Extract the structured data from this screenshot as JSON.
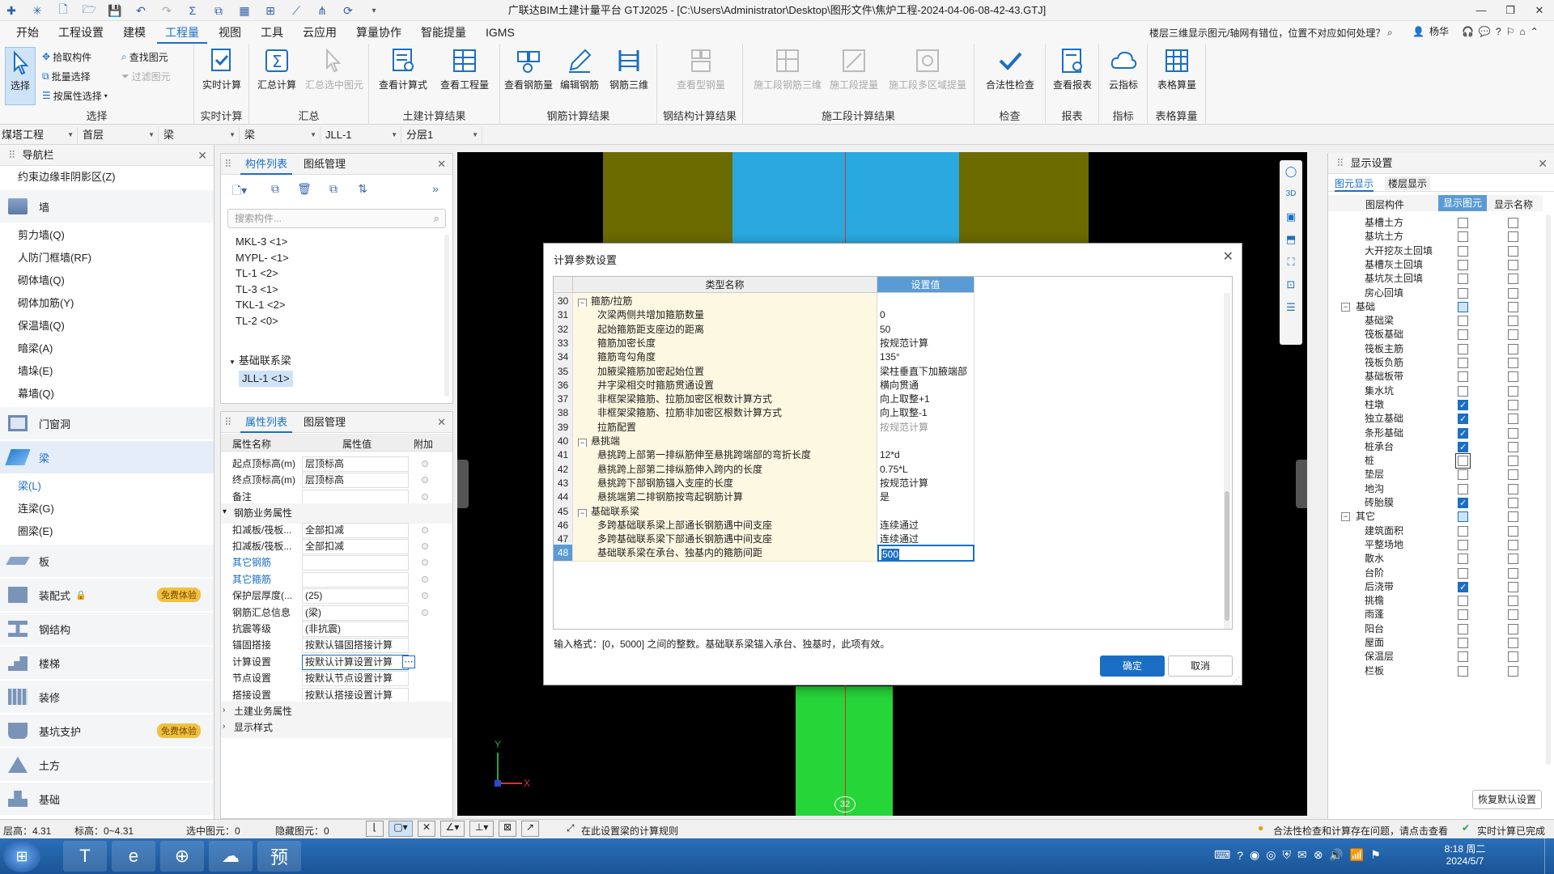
{
  "titlebar": {
    "title": "广联达BIM土建计量平台 GTJ2025 - [C:\\Users\\Administrator\\Desktop\\图形文件\\焦炉工程-2024-04-06-08-42-43.GTJ]",
    "qa_dropdown": "▾"
  },
  "menu": {
    "tabs": [
      "开始",
      "工程设置",
      "建模",
      "工程量",
      "视图",
      "工具",
      "云应用",
      "算量协作",
      "智能提量",
      "IGMS"
    ],
    "active": "工程量",
    "search": "楼层三维显示图元/轴网有错位，位置不对应如何处理？",
    "user": "杨华"
  },
  "ribbon": {
    "select": {
      "label": "选择",
      "pick": "拾取构件",
      "batch": "批量选择",
      "by_attr": "按属性选择",
      "find": "查找图元",
      "filter": "过滤图元",
      "group": "选择"
    },
    "realtime": {
      "label": "实时计算",
      "group": "实时计算"
    },
    "summary": {
      "calc": "汇总计算",
      "sel": "汇总选中图元",
      "group": "汇总"
    },
    "civil": {
      "formula": "查看计算式",
      "quantity": "查看工程量",
      "group": "土建计算结果"
    },
    "rebar": {
      "view": "查看钢筋量",
      "edit": "编辑钢筋",
      "threed": "钢筋三维",
      "group": "钢筋计算结果"
    },
    "steel": {
      "view": "查看型钢量",
      "group": "钢结构计算结果"
    },
    "construction": {
      "rebar3d": "施工段钢筋三维",
      "extract": "施工段提量",
      "multi": "施工段多区域提量",
      "group": "施工段计算结果"
    },
    "check": {
      "label": "合法性检查",
      "group": "检查"
    },
    "report": {
      "label": "查看报表",
      "group": "报表"
    },
    "index": {
      "label": "云指标",
      "group": "指标"
    },
    "table": {
      "label": "表格算量",
      "group": "表格算量"
    }
  },
  "selectors": {
    "project": "煤塔工程",
    "floor": "首层",
    "type": "梁",
    "subtype": "梁",
    "component": "JLL-1",
    "layer": "分层1"
  },
  "nav": {
    "title": "导航栏",
    "top_item": "约束边缘非阴影区(Z)",
    "cat_wall": "墙",
    "wall_items": [
      "剪力墙(Q)",
      "人防门框墙(RF)",
      "砌体墙(Q)",
      "砌体加筋(Y)",
      "保温墙(Q)",
      "暗梁(A)",
      "墙垛(E)",
      "幕墙(Q)"
    ],
    "cat_door": "门窗洞",
    "cat_beam": "梁",
    "beam_items": [
      "梁(L)",
      "连梁(G)",
      "圈梁(E)"
    ],
    "cat_slab": "板",
    "cat_prefab": "装配式",
    "cat_steel": "钢结构",
    "cat_stair": "楼梯",
    "cat_deco": "装修",
    "cat_pit": "基坑支护",
    "cat_earth": "土方",
    "cat_found": "基础",
    "badge": "免费体验"
  },
  "complist": {
    "tab1": "构件列表",
    "tab2": "图纸管理",
    "search_placeholder": "搜索构件...",
    "items": [
      "MKL-3 <1>",
      "MYPL- <1>",
      "TL-1 <2>",
      "TL-3 <1>",
      "TKL-1 <2>",
      "TL-2 <0>"
    ],
    "group": "基础联系梁",
    "current": "JLL-1 <1>"
  },
  "props": {
    "tab1": "属性列表",
    "tab2": "图层管理",
    "col_name": "属性名称",
    "col_value": "属性值",
    "col_extra": "附加",
    "rows": [
      {
        "n": "起点顶标高(m)",
        "v": "层顶标高"
      },
      {
        "n": "终点顶标高(m)",
        "v": "层顶标高"
      },
      {
        "n": "备注",
        "v": ""
      },
      {
        "n": "钢筋业务属性",
        "v": ""
      },
      {
        "n": "扣减板/筏板...",
        "v": "全部扣减"
      },
      {
        "n": "扣减板/筏板...",
        "v": "全部扣减"
      },
      {
        "n": "其它钢筋",
        "v": ""
      },
      {
        "n": "其它箍筋",
        "v": ""
      },
      {
        "n": "保护层厚度(...",
        "v": "(25)"
      },
      {
        "n": "钢筋汇总信息",
        "v": "(梁)"
      },
      {
        "n": "抗震等级",
        "v": "(非抗震)"
      },
      {
        "n": "锚固搭接",
        "v": "按默认锚固搭接计算"
      },
      {
        "n": "计算设置",
        "v": "按默认计算设置计算"
      },
      {
        "n": "节点设置",
        "v": "按默认节点设置计算"
      },
      {
        "n": "搭接设置",
        "v": "按默认搭接设置计算"
      },
      {
        "n": "土建业务属性",
        "v": ""
      },
      {
        "n": "显示样式",
        "v": ""
      }
    ]
  },
  "display": {
    "title": "显示设置",
    "tab1": "图元显示",
    "tab2": "楼层显示",
    "col1": "图层构件",
    "col2": "显示图元",
    "col3": "显示名称",
    "rows": [
      {
        "n": "基槽土方",
        "s": 0,
        "m": 0
      },
      {
        "n": "基坑土方",
        "s": 0,
        "m": 0
      },
      {
        "n": "大开挖灰土回填",
        "s": 0,
        "m": 0
      },
      {
        "n": "基槽灰土回填",
        "s": 0,
        "m": 0
      },
      {
        "n": "基坑灰土回填",
        "s": 0,
        "m": 0
      },
      {
        "n": "房心回填",
        "s": 0,
        "m": 0
      },
      {
        "n": "基础",
        "s": 2,
        "m": 0,
        "g": true
      },
      {
        "n": "基础梁",
        "s": 0,
        "m": 0
      },
      {
        "n": "筏板基础",
        "s": 0,
        "m": 0
      },
      {
        "n": "筏板主筋",
        "s": 0,
        "m": 0
      },
      {
        "n": "筏板负筋",
        "s": 0,
        "m": 0
      },
      {
        "n": "基础板带",
        "s": 0,
        "m": 0
      },
      {
        "n": "集水坑",
        "s": 0,
        "m": 0
      },
      {
        "n": "柱墩",
        "s": 1,
        "m": 0
      },
      {
        "n": "独立基础",
        "s": 1,
        "m": 0
      },
      {
        "n": "条形基础",
        "s": 1,
        "m": 0
      },
      {
        "n": "桩承台",
        "s": 1,
        "m": 0
      },
      {
        "n": "桩",
        "s": 0,
        "m": 0
      },
      {
        "n": "垫层",
        "s": 0,
        "m": 0
      },
      {
        "n": "地沟",
        "s": 0,
        "m": 0
      },
      {
        "n": "砖胎膜",
        "s": 1,
        "m": 0
      },
      {
        "n": "其它",
        "s": 2,
        "m": 0,
        "g": true
      },
      {
        "n": "建筑面积",
        "s": 0,
        "m": 0
      },
      {
        "n": "平整场地",
        "s": 0,
        "m": 0
      },
      {
        "n": "散水",
        "s": 0,
        "m": 0
      },
      {
        "n": "台阶",
        "s": 0,
        "m": 0
      },
      {
        "n": "后浇带",
        "s": 1,
        "m": 0
      },
      {
        "n": "挑檐",
        "s": 0,
        "m": 0
      },
      {
        "n": "雨蓬",
        "s": 0,
        "m": 0
      },
      {
        "n": "阳台",
        "s": 0,
        "m": 0
      },
      {
        "n": "屋面",
        "s": 0,
        "m": 0
      },
      {
        "n": "保温层",
        "s": 0,
        "m": 0
      },
      {
        "n": "栏板",
        "s": 0,
        "m": 0
      }
    ],
    "restore": "恢复默认设置"
  },
  "canvas": {
    "axis_label": "32",
    "y": "Y",
    "x": "X"
  },
  "dialog": {
    "title": "计算参数设置",
    "col_name": "类型名称",
    "col_value": "设置值",
    "rows": [
      {
        "no": "30",
        "name": "箍筋/拉筋",
        "value": "",
        "group": true
      },
      {
        "no": "31",
        "name": "次梁两侧共增加箍筋数量",
        "value": "0"
      },
      {
        "no": "32",
        "name": "起始箍筋距支座边的距离",
        "value": "50"
      },
      {
        "no": "33",
        "name": "箍筋加密长度",
        "value": "按规范计算"
      },
      {
        "no": "34",
        "name": "箍筋弯勾角度",
        "value": "135°"
      },
      {
        "no": "35",
        "name": "加腋梁箍筋加密起始位置",
        "value": "梁柱垂直下加腋端部"
      },
      {
        "no": "36",
        "name": "井字梁相交时箍筋贯通设置",
        "value": "横向贯通"
      },
      {
        "no": "37",
        "name": "非框架梁箍筋、拉筋加密区根数计算方式",
        "value": "向上取整+1"
      },
      {
        "no": "38",
        "name": "非框架梁箍筋、拉筋非加密区根数计算方式",
        "value": "向上取整-1"
      },
      {
        "no": "39",
        "name": "拉筋配置",
        "value": "按规范计算",
        "gray": true
      },
      {
        "no": "40",
        "name": "悬挑端",
        "value": "",
        "group": true
      },
      {
        "no": "41",
        "name": "悬挑跨上部第一排纵筋伸至悬挑跨端部的弯折长度",
        "value": "12*d"
      },
      {
        "no": "42",
        "name": "悬挑跨上部第二排纵筋伸入跨内的长度",
        "value": "0.75*L"
      },
      {
        "no": "43",
        "name": "悬挑跨下部钢筋锚入支座的长度",
        "value": "按规范计算"
      },
      {
        "no": "44",
        "name": "悬挑端第二排钢筋按弯起钢筋计算",
        "value": "是"
      },
      {
        "no": "45",
        "name": "基础联系梁",
        "value": "",
        "group": true
      },
      {
        "no": "46",
        "name": "多跨基础联系梁上部通长钢筋遇中间支座",
        "value": "连续通过"
      },
      {
        "no": "47",
        "name": "多跨基础联系梁下部通长钢筋遇中间支座",
        "value": "连续通过"
      },
      {
        "no": "48",
        "name": "基础联系梁在承台、独基内的箍筋间距",
        "value": "500",
        "current": true
      }
    ],
    "hint": "输入格式：[0，5000] 之间的整数。基础联系梁锚入承台、独基时，此项有效。",
    "ok": "确定",
    "cancel": "取消"
  },
  "status": {
    "floor_height": "层高：4.31",
    "elevation": "标高：0~4.31",
    "selected": "选中图元：0",
    "hidden": "隐藏图元：0",
    "hint": "在此设置梁的计算规则",
    "warning": "合法性检查和计算存在问题，请点击查看",
    "realtime": "实时计算已完成"
  },
  "taskbar": {
    "time": "8:18 周二",
    "date": "2024/5/7",
    "ime": "预"
  },
  "colors": {
    "accent": "#1a6fc4",
    "olive": "#6b6b00",
    "cyan": "#2aa9e0",
    "green": "#26d639"
  }
}
